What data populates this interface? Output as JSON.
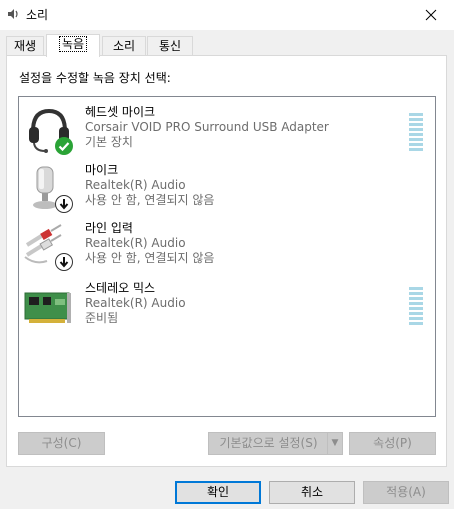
{
  "window": {
    "title": "소리",
    "close_icon": "close-icon"
  },
  "tabs": [
    {
      "label": "재생",
      "active": false
    },
    {
      "label": "녹음",
      "active": true
    },
    {
      "label": "소리",
      "active": false
    },
    {
      "label": "통신",
      "active": false
    }
  ],
  "instruction": "설정을 수정할 녹음 장치 선택:",
  "devices": [
    {
      "name": "헤드셋 마이크",
      "driver": "Corsair VOID PRO Surround USB Adapter",
      "status": "기본 장치",
      "icon": "headset-icon",
      "badge": "default-check-icon"
    },
    {
      "name": "마이크",
      "driver": "Realtek(R) Audio",
      "status": "사용 안 함, 연결되지 않음",
      "icon": "microphone-icon",
      "badge": "down-arrow-icon"
    },
    {
      "name": "라인 입력",
      "driver": "Realtek(R) Audio",
      "status": "사용 안 함, 연결되지 않음",
      "icon": "line-in-cable-icon",
      "badge": "down-arrow-icon"
    },
    {
      "name": "스테레오 믹스",
      "driver": "Realtek(R) Audio",
      "status": "준비됨",
      "icon": "sound-card-icon",
      "badge": ""
    }
  ],
  "buttons": {
    "configure": "구성(C)",
    "set_default": "기본값으로 설정(S)",
    "properties": "속성(P)",
    "ok": "확인",
    "cancel": "취소",
    "apply": "적용(A)"
  },
  "colors": {
    "meter": "#a9d7e6",
    "check_badge": "#2aa336",
    "focus_border": "#0078d7"
  }
}
